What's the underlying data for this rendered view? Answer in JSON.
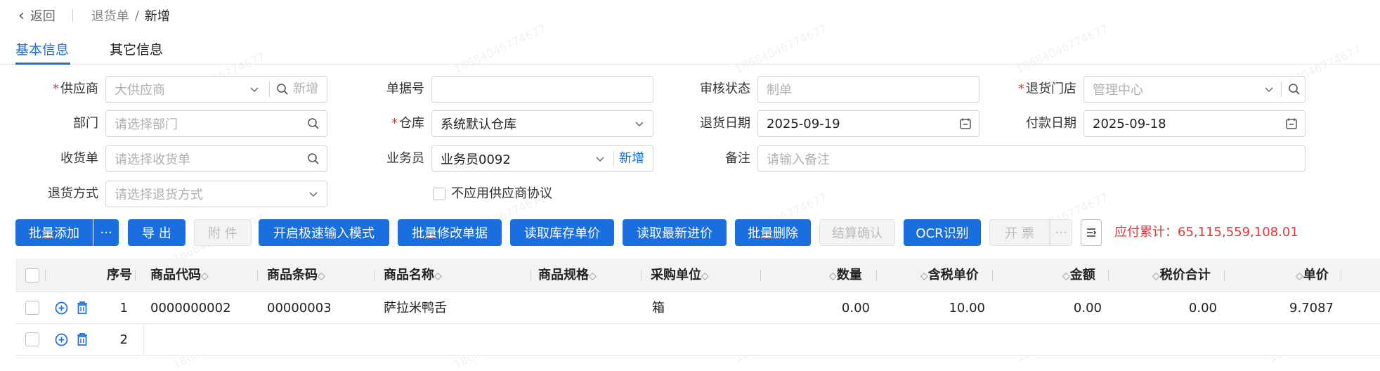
{
  "nav": {
    "back": "返回",
    "crumb_parent": "退货单",
    "crumb_sep": "/",
    "crumb_current": "新增"
  },
  "tabs": [
    {
      "label": "基本信息",
      "active": true
    },
    {
      "label": "其它信息",
      "active": false
    }
  ],
  "form": {
    "supplier": {
      "label": "供应商",
      "placeholder": "大供应商",
      "add": "新增"
    },
    "doc_no": {
      "label": "单据号",
      "value": ""
    },
    "audit_status": {
      "label": "审核状态",
      "placeholder": "制单"
    },
    "return_store": {
      "label": "退货门店",
      "placeholder": "管理中心"
    },
    "dept": {
      "label": "部门",
      "placeholder": "请选择部门"
    },
    "warehouse": {
      "label": "仓库",
      "value": "系统默认仓库"
    },
    "return_date": {
      "label": "退货日期",
      "value": "2025-09-19"
    },
    "pay_date": {
      "label": "付款日期",
      "value": "2025-09-18"
    },
    "receipt": {
      "label": "收货单",
      "placeholder": "请选择收货单"
    },
    "salesman": {
      "label": "业务员",
      "value": "业务员0092",
      "add": "新增"
    },
    "remark": {
      "label": "备注",
      "placeholder": "请输入备注"
    },
    "return_method": {
      "label": "退货方式",
      "placeholder": "请选择退货方式"
    },
    "no_agreement": {
      "label": "不应用供应商协议",
      "checked": false
    }
  },
  "toolbar": {
    "batch_add": "批量添加",
    "more": "···",
    "export": "导 出",
    "attach": "附 件",
    "fast_input": "开启极速输入模式",
    "batch_edit": "批量修改单据",
    "read_stock_price": "读取库存单价",
    "read_latest_price": "读取最新进价",
    "batch_delete": "批量删除",
    "settle_confirm": "结算确认",
    "ocr": "OCR识别",
    "invoice": "开 票",
    "invoice_more": "···",
    "total_label": "应付累计：",
    "total_value": "65,115,559,108.01"
  },
  "table": {
    "headers": {
      "seq": "序号",
      "code": "商品代码",
      "barcode": "商品条码",
      "name": "商品名称",
      "spec": "商品规格",
      "unit": "采购单位",
      "qty": "数量",
      "tax_price": "含税单价",
      "amount": "金额",
      "total": "税价合计",
      "price": "单价"
    },
    "rows": [
      {
        "seq": "1",
        "code": "0000000002",
        "barcode": "00000003",
        "name": "萨拉米鸭舌",
        "spec": "",
        "unit": "箱",
        "qty": "0.00",
        "tax_price": "10.00",
        "amount": "0.00",
        "total": "0.00",
        "price": "9.7087"
      },
      {
        "seq": "2",
        "code": "",
        "barcode": "",
        "name": "",
        "spec": "",
        "unit": "",
        "qty": "",
        "tax_price": "",
        "amount": "",
        "total": "",
        "price": ""
      }
    ]
  },
  "watermark": "18684046774677",
  "colors": {
    "primary": "#1a6fe0",
    "required": "#e23a3a",
    "total": "#e23a3a"
  }
}
